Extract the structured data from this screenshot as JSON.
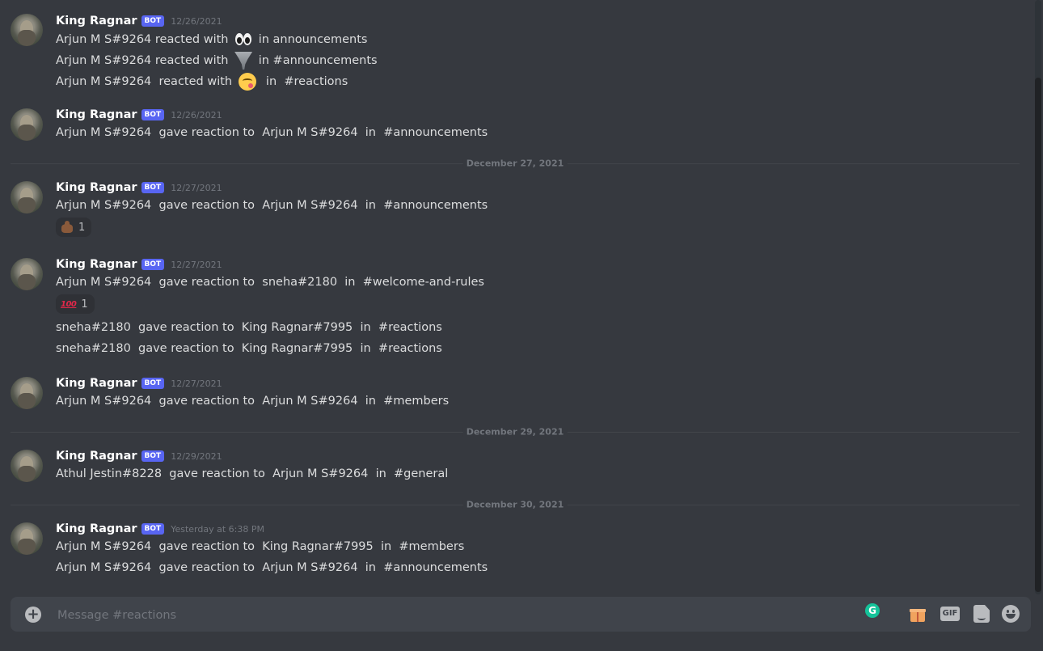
{
  "feed": {
    "author": "King Ragnar",
    "bot_tag": "BOT",
    "groups": [
      {
        "timestamp": "12/26/2021",
        "lines": [
          "Arjun M S#9264 reacted with ",
          "Arjun M S#9264 reacted with ",
          "Arjun M S#9264  reacted with "
        ],
        "line_suffixes": [
          " in announcements",
          " in #announcements",
          "  in  #reactions"
        ],
        "emoji_icons": [
          "eyes-icon",
          "tornado-icon",
          "yum-face-icon"
        ]
      },
      {
        "timestamp": "12/26/2021",
        "lines": [
          "Arjun M S#9264  gave reaction to  Arjun M S#9264  in  #announcements"
        ]
      },
      {
        "timestamp": "12/27/2021",
        "lines": [
          "Arjun M S#9264  gave reaction to  Arjun M S#9264  in  #announcements"
        ],
        "reaction": {
          "icon": "poop-icon",
          "count": "1"
        }
      },
      {
        "timestamp": "12/27/2021",
        "lines": [
          "Arjun M S#9264  gave reaction to  sneha#2180  in  #welcome-and-rules",
          "sneha#2180  gave reaction to  King Ragnar#7995  in  #reactions",
          "sneha#2180  gave reaction to  King Ragnar#7995  in  #reactions"
        ],
        "reaction": {
          "icon": "hundred-points-icon",
          "label": "100",
          "count": "1"
        }
      },
      {
        "timestamp": "12/27/2021",
        "lines": [
          "Arjun M S#9264  gave reaction to  Arjun M S#9264  in  #members"
        ]
      },
      {
        "timestamp": "12/29/2021",
        "lines": [
          "Athul Jestin#8228  gave reaction to  Arjun M S#9264  in  #general"
        ]
      },
      {
        "timestamp": "Yesterday at 6:38 PM",
        "lines": [
          "Arjun M S#9264  gave reaction to  King Ragnar#7995  in  #members",
          "Arjun M S#9264  gave reaction to  Arjun M S#9264  in  #announcements"
        ]
      }
    ],
    "dividers": [
      "December 27, 2021",
      "December 29, 2021",
      "December 30, 2021"
    ]
  },
  "composer": {
    "placeholder": "Message #reactions",
    "gif_label": "GIF",
    "grammarly_label": "G"
  },
  "colors": {
    "background": "#36393f",
    "bot_badge": "#5865f2",
    "composer": "#40444b"
  }
}
